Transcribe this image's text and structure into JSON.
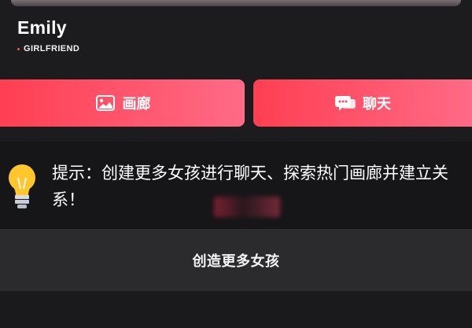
{
  "profile": {
    "name": "Emily",
    "tag": "GIRLFRIEND"
  },
  "actions": {
    "gallery_label": "画廊",
    "chat_label": "聊天"
  },
  "tip": {
    "text": "提示：创建更多女孩进行聊天、探索热门画廊并建立关系！"
  },
  "create_button": {
    "label": "创造更多女孩"
  },
  "icons": {
    "gallery": "image-icon",
    "chat": "chat-bubble-icon",
    "tip": "lightbulb-icon"
  },
  "colors": {
    "accent_start": "#ff3f52",
    "accent_end": "#ff6a86",
    "background": "#1c1c1e"
  }
}
